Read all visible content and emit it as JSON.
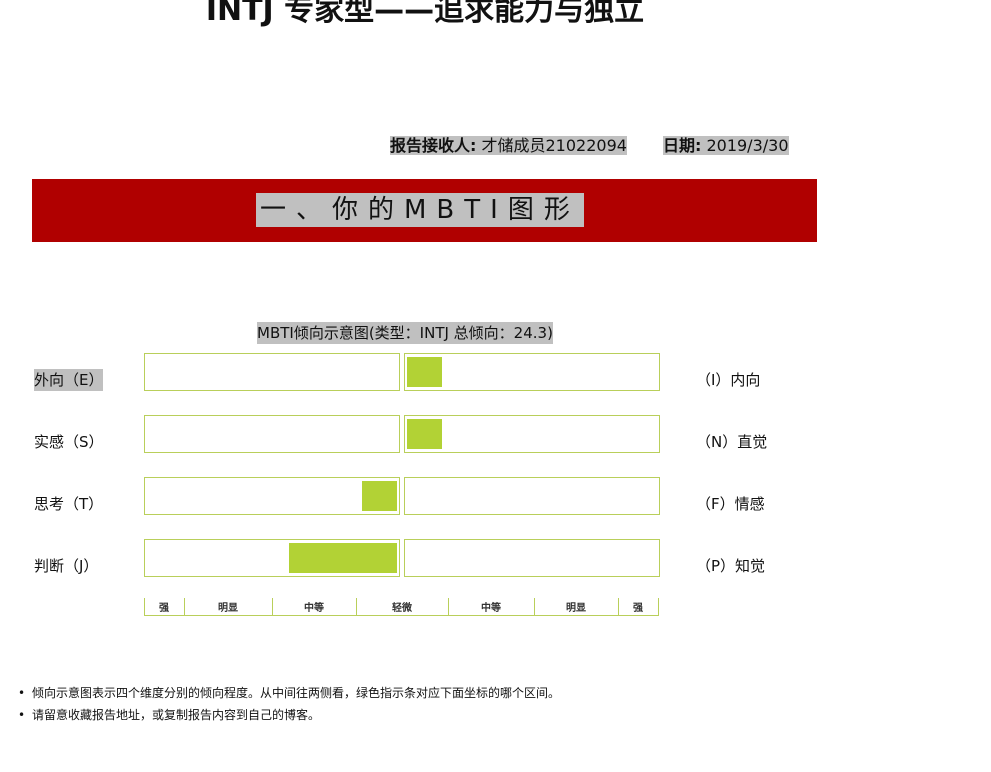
{
  "title": "INTJ 专家型——追求能力与独立",
  "meta": {
    "recipient_label": "报告接收人:",
    "recipient_value": "才储成员21022094",
    "date_label": "日期:",
    "date_value": "2019/3/30"
  },
  "section_heading": "一、你的MBTI图形",
  "chart_data": {
    "type": "bar",
    "title": "MBTI倾向示意图(类型：INTJ 总倾向：24.3)",
    "dimensions": [
      {
        "left": "外向（E）",
        "right": "（I）内向",
        "side": "right",
        "level": 0.14
      },
      {
        "left": "实感（S）",
        "right": "（N）直觉",
        "side": "right",
        "level": 0.14
      },
      {
        "left": "思考（T）",
        "right": "（F）情感",
        "side": "left",
        "level": 0.14
      },
      {
        "left": "判断（J）",
        "right": "（P）知觉",
        "side": "left",
        "level": 0.43
      }
    ],
    "scale_labels": [
      "强",
      "明显",
      "中等",
      "轻微",
      "中等",
      "明显",
      "强"
    ],
    "colors": {
      "bar": "#b2d235",
      "border": "#b9cf5a",
      "banner": "#b00000"
    }
  },
  "notes": [
    "倾向示意图表示四个维度分别的倾向程度。从中间往两侧看，绿色指示条对应下面坐标的哪个区间。",
    "请留意收藏报告地址，或复制报告内容到自己的博客。"
  ]
}
